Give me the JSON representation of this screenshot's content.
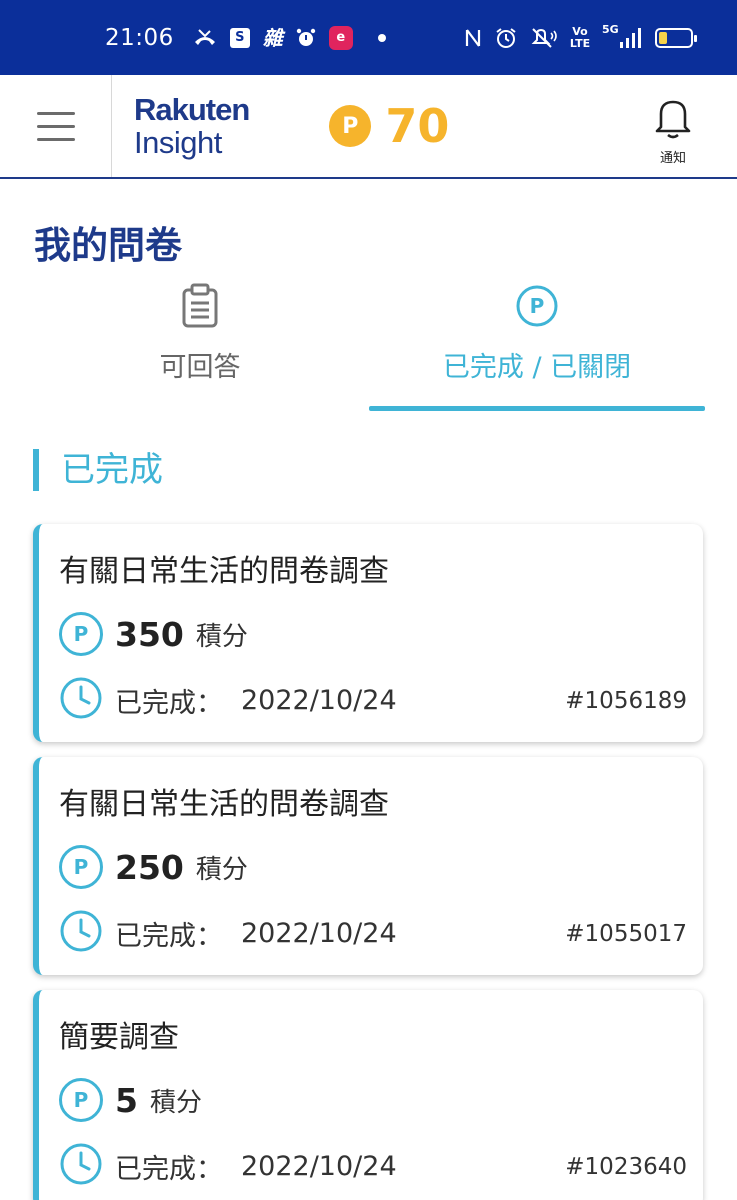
{
  "status_bar": {
    "time": "21:06",
    "left_icons": [
      "missed-call-icon",
      "shopee-icon",
      "news-icon",
      "alarm-icon",
      "app-icon",
      "dot-icon"
    ],
    "right_icons": [
      "nfc-icon",
      "alarm-icon",
      "mute-icon",
      "volte-icon",
      "5g-signal-icon",
      "battery-icon"
    ],
    "volte_text": "Vo LTE",
    "network_text": "5G",
    "bag_glyph": "S",
    "news_glyph": "雜",
    "app_glyph": "e",
    "battery_level": 0.25
  },
  "header": {
    "logo_top": "Rakuten",
    "logo_bottom": "Insight",
    "points_icon_letter": "P",
    "points_value": "70",
    "notify_label": "通知"
  },
  "page": {
    "title": "我的問卷",
    "tabs": [
      {
        "label": "可回答",
        "icon": "clipboard-icon",
        "active": false
      },
      {
        "label": "已完成 / 已關閉",
        "icon": "points-circle-icon",
        "active": true
      }
    ],
    "section_heading": "已完成"
  },
  "cards": [
    {
      "title": "有關日常生活的問卷調查",
      "points": "350",
      "points_unit": "積分",
      "done_label": "已完成：",
      "done_date": "2022/10/24",
      "id": "#1056189"
    },
    {
      "title": "有關日常生活的問卷調查",
      "points": "250",
      "points_unit": "積分",
      "done_label": "已完成：",
      "done_date": "2022/10/24",
      "id": "#1055017"
    },
    {
      "title": "簡要調查",
      "points": "5",
      "points_unit": "積分",
      "done_label": "已完成：",
      "done_date": "2022/10/24",
      "id": "#1023640"
    }
  ],
  "colors": {
    "status_bar": "#0b2f9a",
    "brand_navy": "#1e3a8a",
    "accent_cyan": "#3fb4d6",
    "points_gold": "#f6b42c"
  }
}
